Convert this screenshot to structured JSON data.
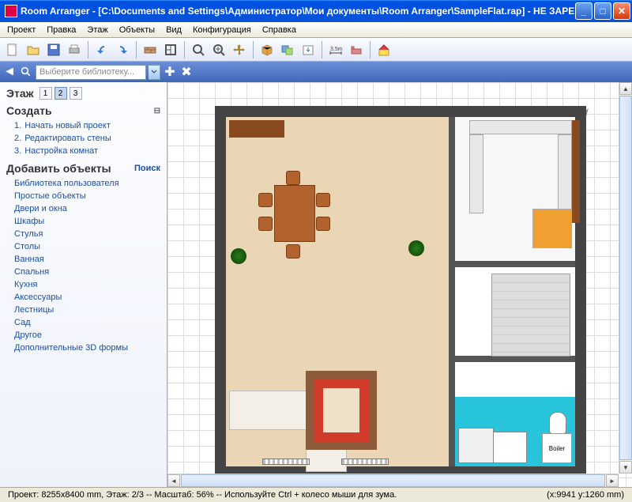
{
  "title": "Room Arranger - [C:\\Documents and Settings\\Администратор\\Мои документы\\Room Arranger\\SampleFlat.rap] - НЕ ЗАРЕГИСТРИРО...",
  "menu": [
    "Проект",
    "Правка",
    "Этаж",
    "Объекты",
    "Вид",
    "Конфигурация",
    "Справка"
  ],
  "search_placeholder": "Выберите библиотеку...",
  "floor_label": "Этаж",
  "floors": [
    "1",
    "2",
    "3"
  ],
  "active_floor": "2",
  "create_header": "Создать",
  "create_items": [
    {
      "num": "1.",
      "label": "Начать новый проект"
    },
    {
      "num": "2.",
      "label": "Редактировать стены"
    },
    {
      "num": "3.",
      "label": "Настройка комнат"
    }
  ],
  "add_header": "Добавить объекты",
  "add_search": "Поиск",
  "categories": [
    "Библиотека пользователя",
    "Простые объекты",
    "Двери и окна",
    "Шкафы",
    "Стулья",
    "Столы",
    "Ванная",
    "Спальня",
    "Кухня",
    "Аксессуары",
    "Лестницы",
    "Сад",
    "Другое",
    "Дополнительные 3D формы"
  ],
  "boiler_label": "Boiler",
  "status_left": "Проект: 8255x8400 mm, Этаж: 2/3 -- Масштаб: 56% -- Используйте Ctrl + колесо мыши для зума.",
  "status_coords": "(x:9941 y:1260 mm)"
}
